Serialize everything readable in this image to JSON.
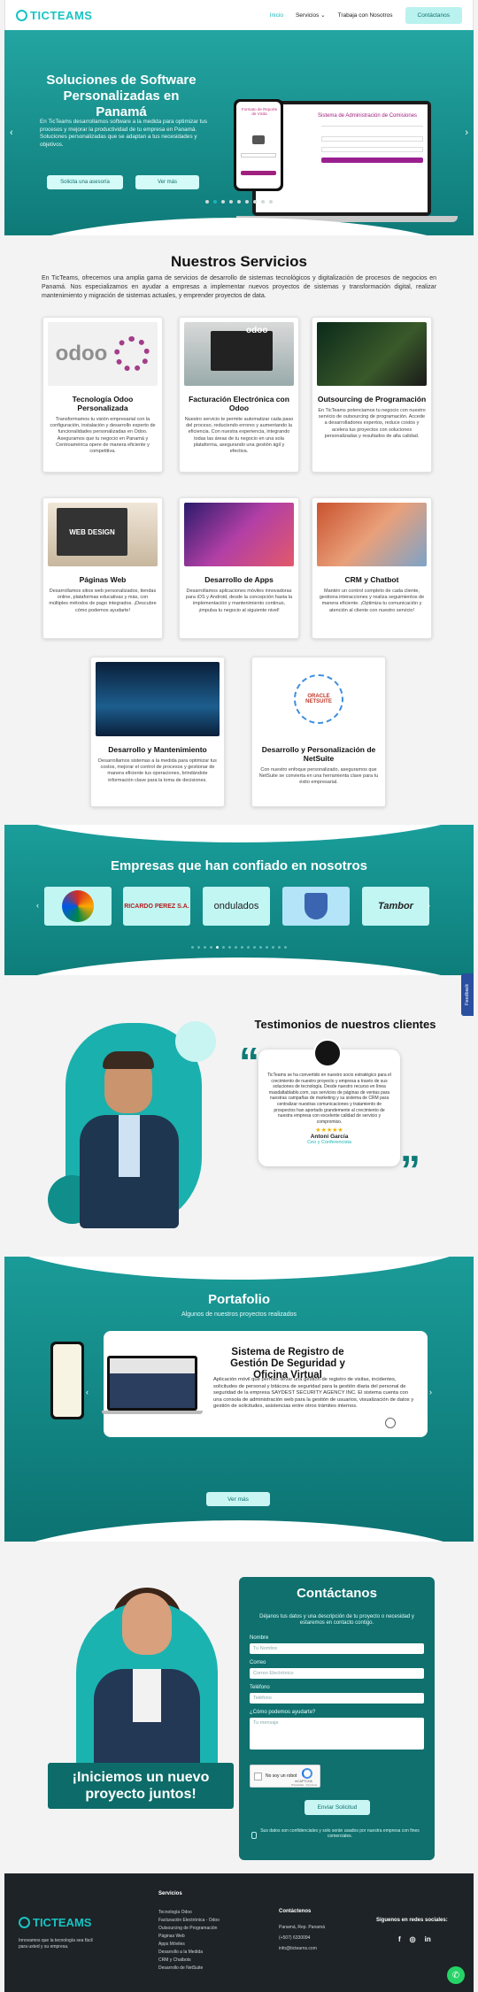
{
  "header": {
    "logo": "TICTEAMS",
    "nav": [
      "Inicio",
      "Servicios",
      "Trabaja con Nosotros"
    ],
    "nav_chevron": "⌄",
    "contact_btn": "Contáctanos"
  },
  "hero": {
    "title": "Soluciones de Software Personalizadas en Panamá",
    "text": "En TicTeams desarrollamos software a la medida para optimizar tus procesos y mejorar la productividad de tu empresa en Panamá. Soluciones personalizadas que se adaptan a tus necesidades y objetivos.",
    "btn1": "Solicita una asesoría",
    "btn2": "Ver más",
    "screen_title": "Sistema de Administración de Comisiones",
    "phone_text": "Formato de Reporte de Visita",
    "slide_count": 9,
    "active_slide": 1
  },
  "services": {
    "title": "Nuestros Servicios",
    "intro": "En TicTeams, ofrecemos una amplia gama de servicios de desarrollo de sistemas tecnológicos y digitalización de procesos de negocios en Panamá. Nos especializamos en ayudar a empresas a implementar nuevos proyectos de sistemas y transformación digital, realizar mantenimiento y migración de sistemas actuales, y emprender proyectos de data.",
    "cards": [
      {
        "title": "Tecnología Odoo Personalizada",
        "text": "Transformamos tu visión empresarial con la configuración, instalación y desarrollo experto de funcionalidades personalizadas en Odoo. Aseguramos que tu negocio en Panamá y Centroamérica opere de manera eficiente y competitiva."
      },
      {
        "title": "Facturación Electrónica con Odoo",
        "text": "Nuestro servicio te permite automatizar cada paso del proceso, reduciendo errores y aumentando la eficiencia. Con nuestra experiencia, integrando todas las áreas de tu negocio en una sola plataforma, asegurando una gestión ágil y efectiva."
      },
      {
        "title": "Outsourcing de Programación",
        "text": "En TicTeams potenciamos tu negocio con nuestro servicio de outsourcing de programación. Accede a desarrolladores expertos, reduce costos y acelera tus proyectos con soluciones personalizadas y resultados de alta calidad."
      },
      {
        "title": "Páginas Web",
        "text": "Desarrollamos sitios web personalizados, tiendas online, plataformas educativas y más, con múltiples métodos de pago integrados. ¡Descubre cómo podemos ayudarte!"
      },
      {
        "title": "Desarrollo de Apps",
        "text": "Desarrollamos aplicaciones móviles innovadoras para iOS y Android, desde la concepción hasta la implementación y mantenimiento continuo, ¡impulsa tu negocio al siguiente nivel!"
      },
      {
        "title": "CRM y Chatbot",
        "text": "Mantén un control completo de cada cliente, gestiona interacciones y realiza seguimientos de manera eficiente. ¡Optimiza tu comunicación y atención al cliente con nuestro servicio!"
      },
      {
        "title": "Desarrollo y Mantenimiento",
        "text": "Desarrollamos sistemas a la medida para optimizar tus costos, mejorar el control de procesos y gestionar de manera eficiente tus operaciones, brindándote información clave para la toma de decisiones."
      },
      {
        "title": "Desarrollo y Personalización de NetSuite",
        "text": "Con nuestro enfoque personalizado, aseguramos que NetSuite se convierta en una herramienta clave para tu éxito empresarial."
      }
    ],
    "img_labels": {
      "odoo": "odoo",
      "web_design": "WEB DESIGN",
      "oracle": "ORACLE NETSUITE"
    }
  },
  "clients": {
    "title": "Empresas que han confiado en nosotros",
    "brands": [
      "",
      "RICARDO PEREZ S.A.",
      "ondulados",
      "",
      "Tambor"
    ],
    "dot_count": 16,
    "active_dot": 4
  },
  "testimonials": {
    "title": "Testimonios de nuestros clientes",
    "quote": "TicTeams se ha convertido en nuestro socio estratégico para el crecimiento de nuestro proyecto y empresa a través de sus soluciones de tecnología. Desde nuestro recurso en línea masdaltablablo.com, sus servicios de páginas de ventas para nuestras campañas de marketing y su sistema de CRM para centralizar nuestras comunicaciones y tratamiento de prospectos han aportado grandemente al crecimiento de nuestra empresa con excelente calidad de servicio y compromiso.",
    "stars": "★★★★★",
    "author": "Antoni García",
    "role": "Ceo y Conferencista",
    "feedback": "Feedback"
  },
  "portfolio": {
    "title": "Portafolio",
    "subtitle": "Algunos de nuestros proyectos realizados",
    "project_title": "Sistema de Registro de Gestión De Seguridad y Oficina Virtual",
    "project_text": "Aplicación móvil que permite llevar una gestión de registro de visitas, incidentes, solicitudes de personal y bitácora de seguridad para la gestión diaria del personal de seguridad de la empresa SAYDEST SECURITY AGENCY INC. El sistema cuenta con una consola de administración web para la gestión de usuarios, visualización de datos y gestión de solicitudes, asistencias entre otros trámites internos.",
    "btn": "Ver más"
  },
  "contact": {
    "title": "Contáctanos",
    "intro": "Déjanos tus datos y una descripción de tu proyecto o necesidad y estaremos en contacto contigo.",
    "labels": [
      "Nombre",
      "Correo",
      "Teléfono",
      "¿Cómo podemos ayudarte?"
    ],
    "placeholders": [
      "Tu Nombre",
      "Correo Electrónico",
      "Teléfono",
      "Tu mensaje"
    ],
    "captcha": "No soy un robot",
    "captcha_brand": "reCAPTCHA",
    "captcha_sub": "Privacidad - Términos",
    "submit": "Enviar Solicitud",
    "note": "Sus datos son confidenciales y solo serán usados por nuestra empresa con fines comerciales.",
    "banner": "¡Iniciemos un nuevo proyecto juntos!"
  },
  "footer": {
    "tagline": "Innovamos que la tecnología sea fácil para usted y su empresa.",
    "services_title": "Servicios",
    "services": [
      "Tecnología Odoo",
      "Facturación Electrónica - Odoo",
      "Outsourcing de Programación",
      "Páginas Web",
      "Apps Móviles",
      "Desarrollo a la Medida",
      "CRM y Chatbots",
      "Desarrollo de NetSuite"
    ],
    "contact_title": "Contáctenos",
    "address": "Panamá, Rep. Panamá",
    "phone": "(+507) 6330094",
    "email": "info@tictearns.com",
    "social_title": "Síguenos en redes sociales:",
    "social": [
      "f",
      "◎",
      "in"
    ]
  },
  "colors": {
    "primary": "#19b5b5",
    "dark_teal": "#0e7a78",
    "light_teal": "#c2f6f3",
    "footer": "#1d2326"
  }
}
